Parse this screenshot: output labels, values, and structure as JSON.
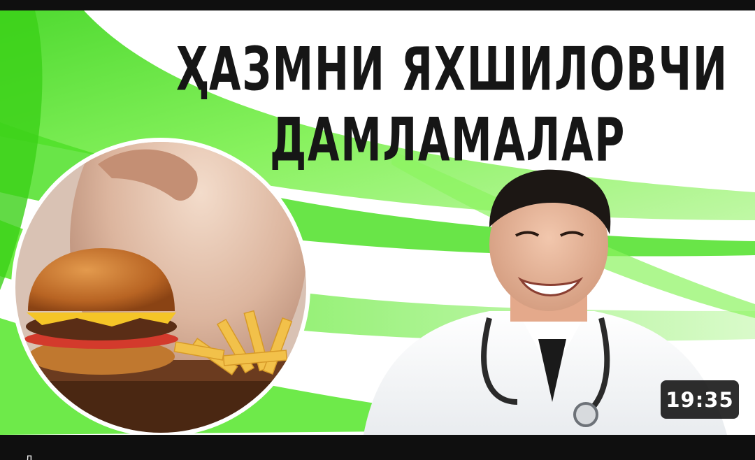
{
  "video": {
    "title_line_1": "ҲАЗМНИ ЯХШИЛОВЧИ",
    "title_line_2": "ДАМЛАМАЛАР",
    "duration": "19:35"
  },
  "below": {
    "title_peek": "Д"
  },
  "colors": {
    "background": "#0f0f0f",
    "accent_green": "#4fe028",
    "title_text": "#161616",
    "badge_bg": "#000000"
  }
}
